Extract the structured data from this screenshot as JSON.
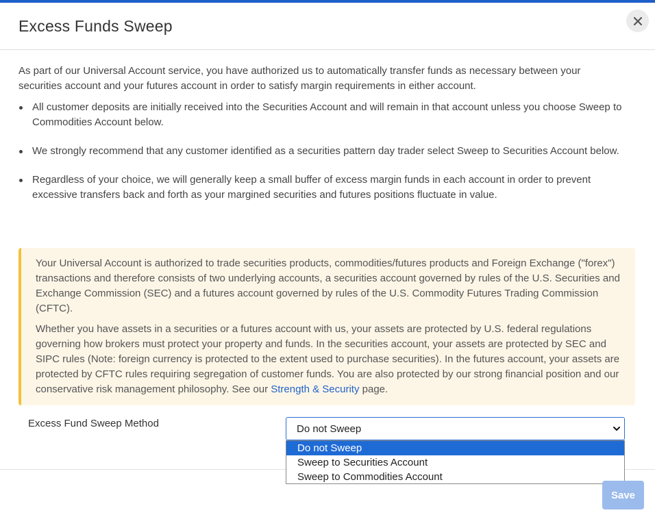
{
  "colors": {
    "accent": "#1f5fc9",
    "notice_bg": "#fdf6e7",
    "notice_border": "#f3c13a",
    "link": "#2563c9",
    "save_disabled": "#9bbbec",
    "option_selected": "#1f6bd6"
  },
  "modal": {
    "title": "Excess Funds Sweep",
    "close_icon": "close-icon"
  },
  "intro": "As part of our Universal Account service, you have authorized us to automatically transfer funds as necessary between your securities account and your futures account in order to satisfy margin requirements in either account.",
  "bullets": [
    "All customer deposits are initially received into the Securities Account and will remain in that account unless you choose Sweep to Commodities Account below.",
    "We strongly recommend that any customer identified as a securities pattern day trader select Sweep to Securities Account below.",
    "Regardless of your choice, we will generally keep a small buffer of excess margin funds in each account in order to prevent excessive transfers back and forth as your margined securities and futures positions fluctuate in value."
  ],
  "notice": {
    "para1": "Your Universal Account is authorized to trade securities products, commodities/futures products and Foreign Exchange (\"forex\") transactions and therefore consists of two underlying accounts, a securities account governed by rules of the U.S. Securities and Exchange Commission (SEC) and a futures account governed by rules of the U.S. Commodity Futures Trading Commission (CFTC).",
    "para2_before": "Whether you have assets in a securities or a futures account with us, your assets are protected by U.S. federal regulations governing how brokers must protect your property and funds. In the securities account, your assets are protected by SEC and SIPC rules (Note: foreign currency is protected to the extent used to purchase securities). In the futures account, your assets are protected by CFTC rules requiring segregation of customer funds. You are also protected by our strong financial position and our conservative risk management philosophy. See our ",
    "link_text": "Strength & Security",
    "para2_after": " page."
  },
  "sweep": {
    "label": "Excess Fund Sweep Method",
    "selected": "Do not Sweep",
    "options": [
      "Do not Sweep",
      "Sweep to Securities Account",
      "Sweep to Commodities Account"
    ]
  },
  "footer": {
    "save_label": "Save"
  }
}
